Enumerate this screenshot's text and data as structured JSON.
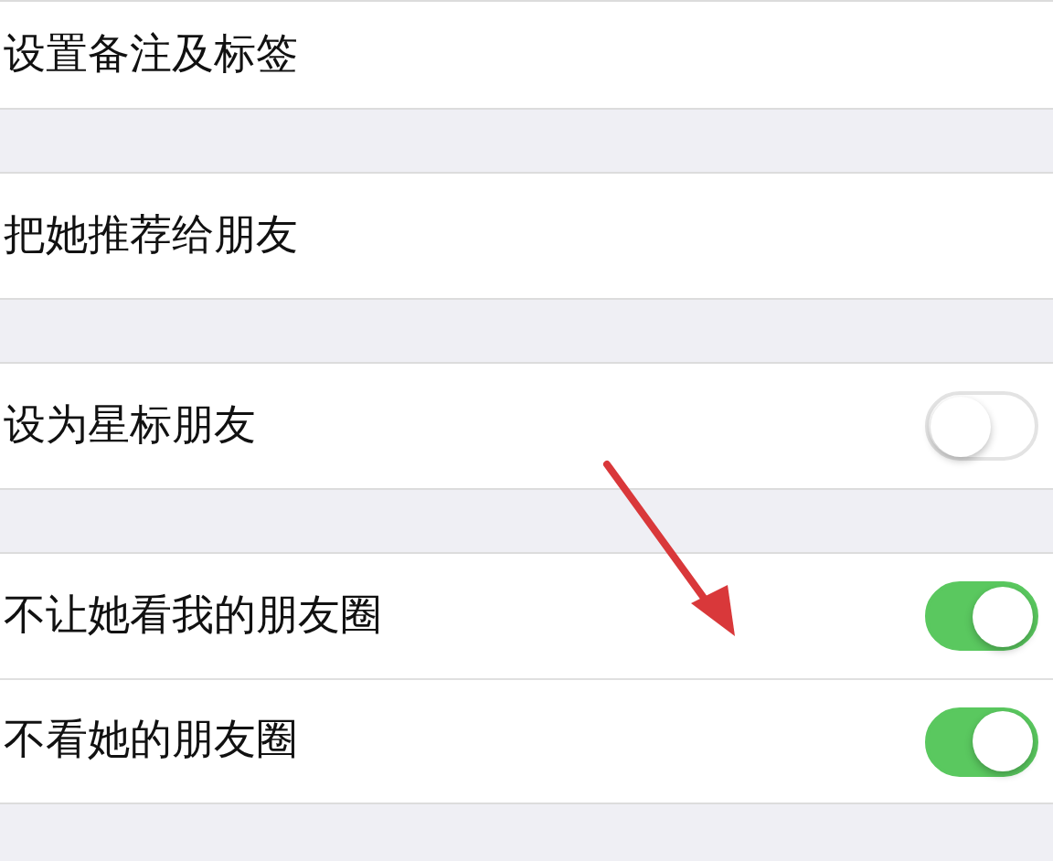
{
  "groups": [
    {
      "rows": [
        {
          "label": "设置备注及标签",
          "kind": "plain"
        }
      ]
    },
    {
      "rows": [
        {
          "label": "把她推荐给朋友",
          "kind": "plain"
        }
      ]
    },
    {
      "rows": [
        {
          "label": "设为星标朋友",
          "kind": "toggle",
          "on": false
        }
      ]
    },
    {
      "rows": [
        {
          "label": "不让她看我的朋友圈",
          "kind": "toggle",
          "on": true
        },
        {
          "label": "不看她的朋友圈",
          "kind": "toggle",
          "on": true
        }
      ]
    }
  ]
}
